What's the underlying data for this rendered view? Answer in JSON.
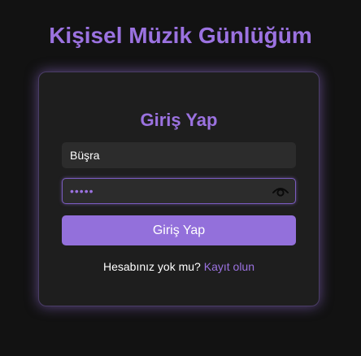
{
  "app": {
    "title": "Kişisel Müzik Günlüğüm"
  },
  "login": {
    "heading": "Giriş Yap",
    "username_value": "Büşra",
    "password_value": "•••••",
    "password_toggle_icon": "eye-icon",
    "submit_label": "Giriş Yap",
    "signup_prompt": "Hesabınız yok mu?",
    "signup_link": "Kayıt olun"
  },
  "colors": {
    "accent": "#9b72e0",
    "button": "#9370db",
    "background": "#121212",
    "card": "#1e1e1e",
    "input": "#2c2c2c"
  }
}
